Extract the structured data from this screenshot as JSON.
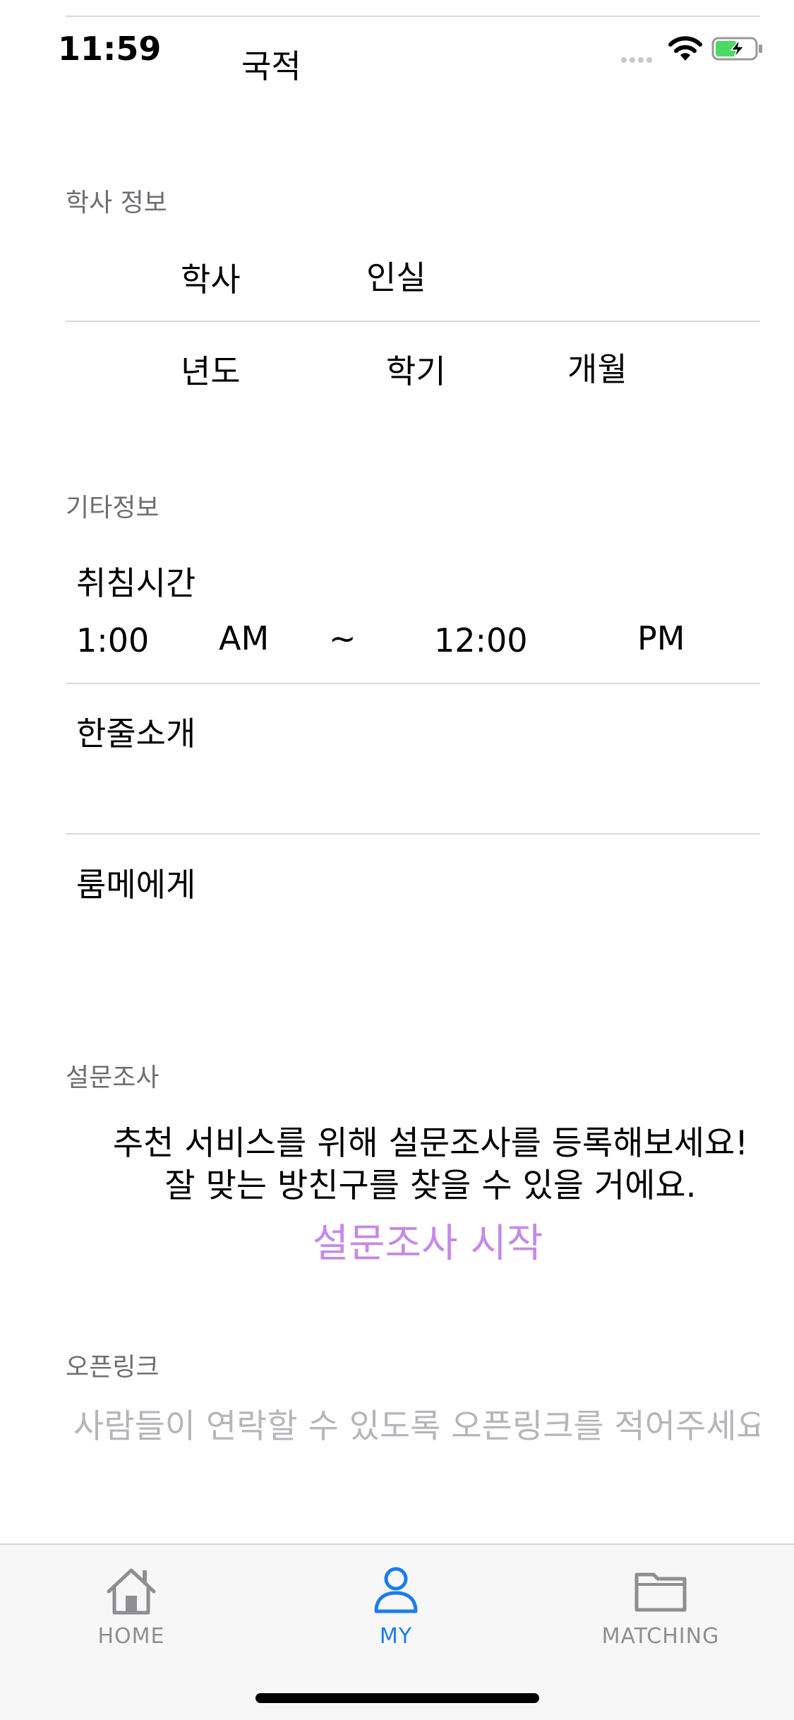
{
  "status_bar": {
    "time": "11:59"
  },
  "nationality": {
    "label": "국적"
  },
  "academic": {
    "header": "학사 정보",
    "degree": "학사",
    "room_type": "인실",
    "year": "년도",
    "semester": "학기",
    "months": "개월"
  },
  "other_info": {
    "header": "기타정보",
    "bedtime_label": "취침시간",
    "start_time": "1:00",
    "start_ampm": "AM",
    "separator": "~",
    "end_time": "12:00",
    "end_ampm": "PM",
    "intro_label": "한줄소개",
    "to_roommate_label": "룸메에게"
  },
  "survey": {
    "header": "설문조사",
    "line1": "추천 서비스를 위해 설문조사를 등록해보세요!",
    "line2": "잘 맞는 방친구를 찾을 수 있을 거에요.",
    "start_button": "설문조사 시작"
  },
  "openlink": {
    "header": "오픈링크",
    "placeholder": "사람들이 연락할 수 있도록 오픈링크를 적어주세요",
    "value": ""
  },
  "tabbar": {
    "tabs": [
      {
        "label": "HOME",
        "icon": "house-icon",
        "active": false
      },
      {
        "label": "MY",
        "icon": "person-icon",
        "active": true
      },
      {
        "label": "MATCHING",
        "icon": "folder-icon",
        "active": false
      }
    ]
  },
  "colors": {
    "accent_tab": "#1a7cf0",
    "survey_link": "#c58ae6",
    "inactive_tab": "#8e8e93",
    "battery_fill": "#4cd964"
  }
}
